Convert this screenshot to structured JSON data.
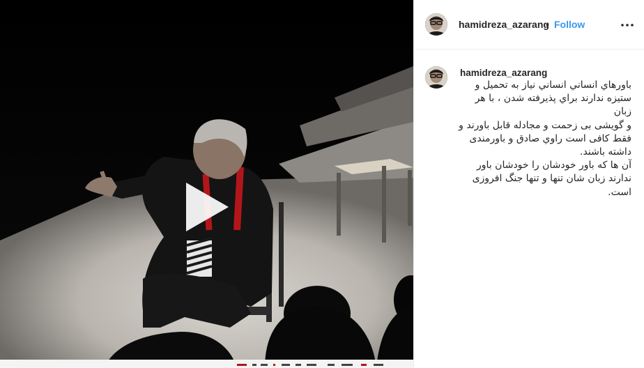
{
  "post": {
    "username": "hamidreza_azarang",
    "separator": "•",
    "follow_label": "Follow"
  },
  "caption": {
    "username": "hamidreza_azarang",
    "username_suffix": ".",
    "lines": [
      "باورهاي انساني انساني نياز به تحميل و",
      "ستيزه ندارند براي پذيرفته شدن ، با هر زبان",
      "و گويشی بی زحمت و مجادله قابل باورند و",
      "فقط كافی است راوي صادق و باورمندی",
      "داشته باشند.",
      "آن ها كه باور خودشان را خودشان باور",
      "ندارند زبان شان تنها و تنها جنگ افروزی",
      "است."
    ]
  },
  "icons": {
    "play": "play-icon",
    "more": "more-options-icon",
    "avatar": "profile-avatar"
  },
  "colors": {
    "link": "#3897f0",
    "text": "#262626",
    "border": "#efefef"
  }
}
